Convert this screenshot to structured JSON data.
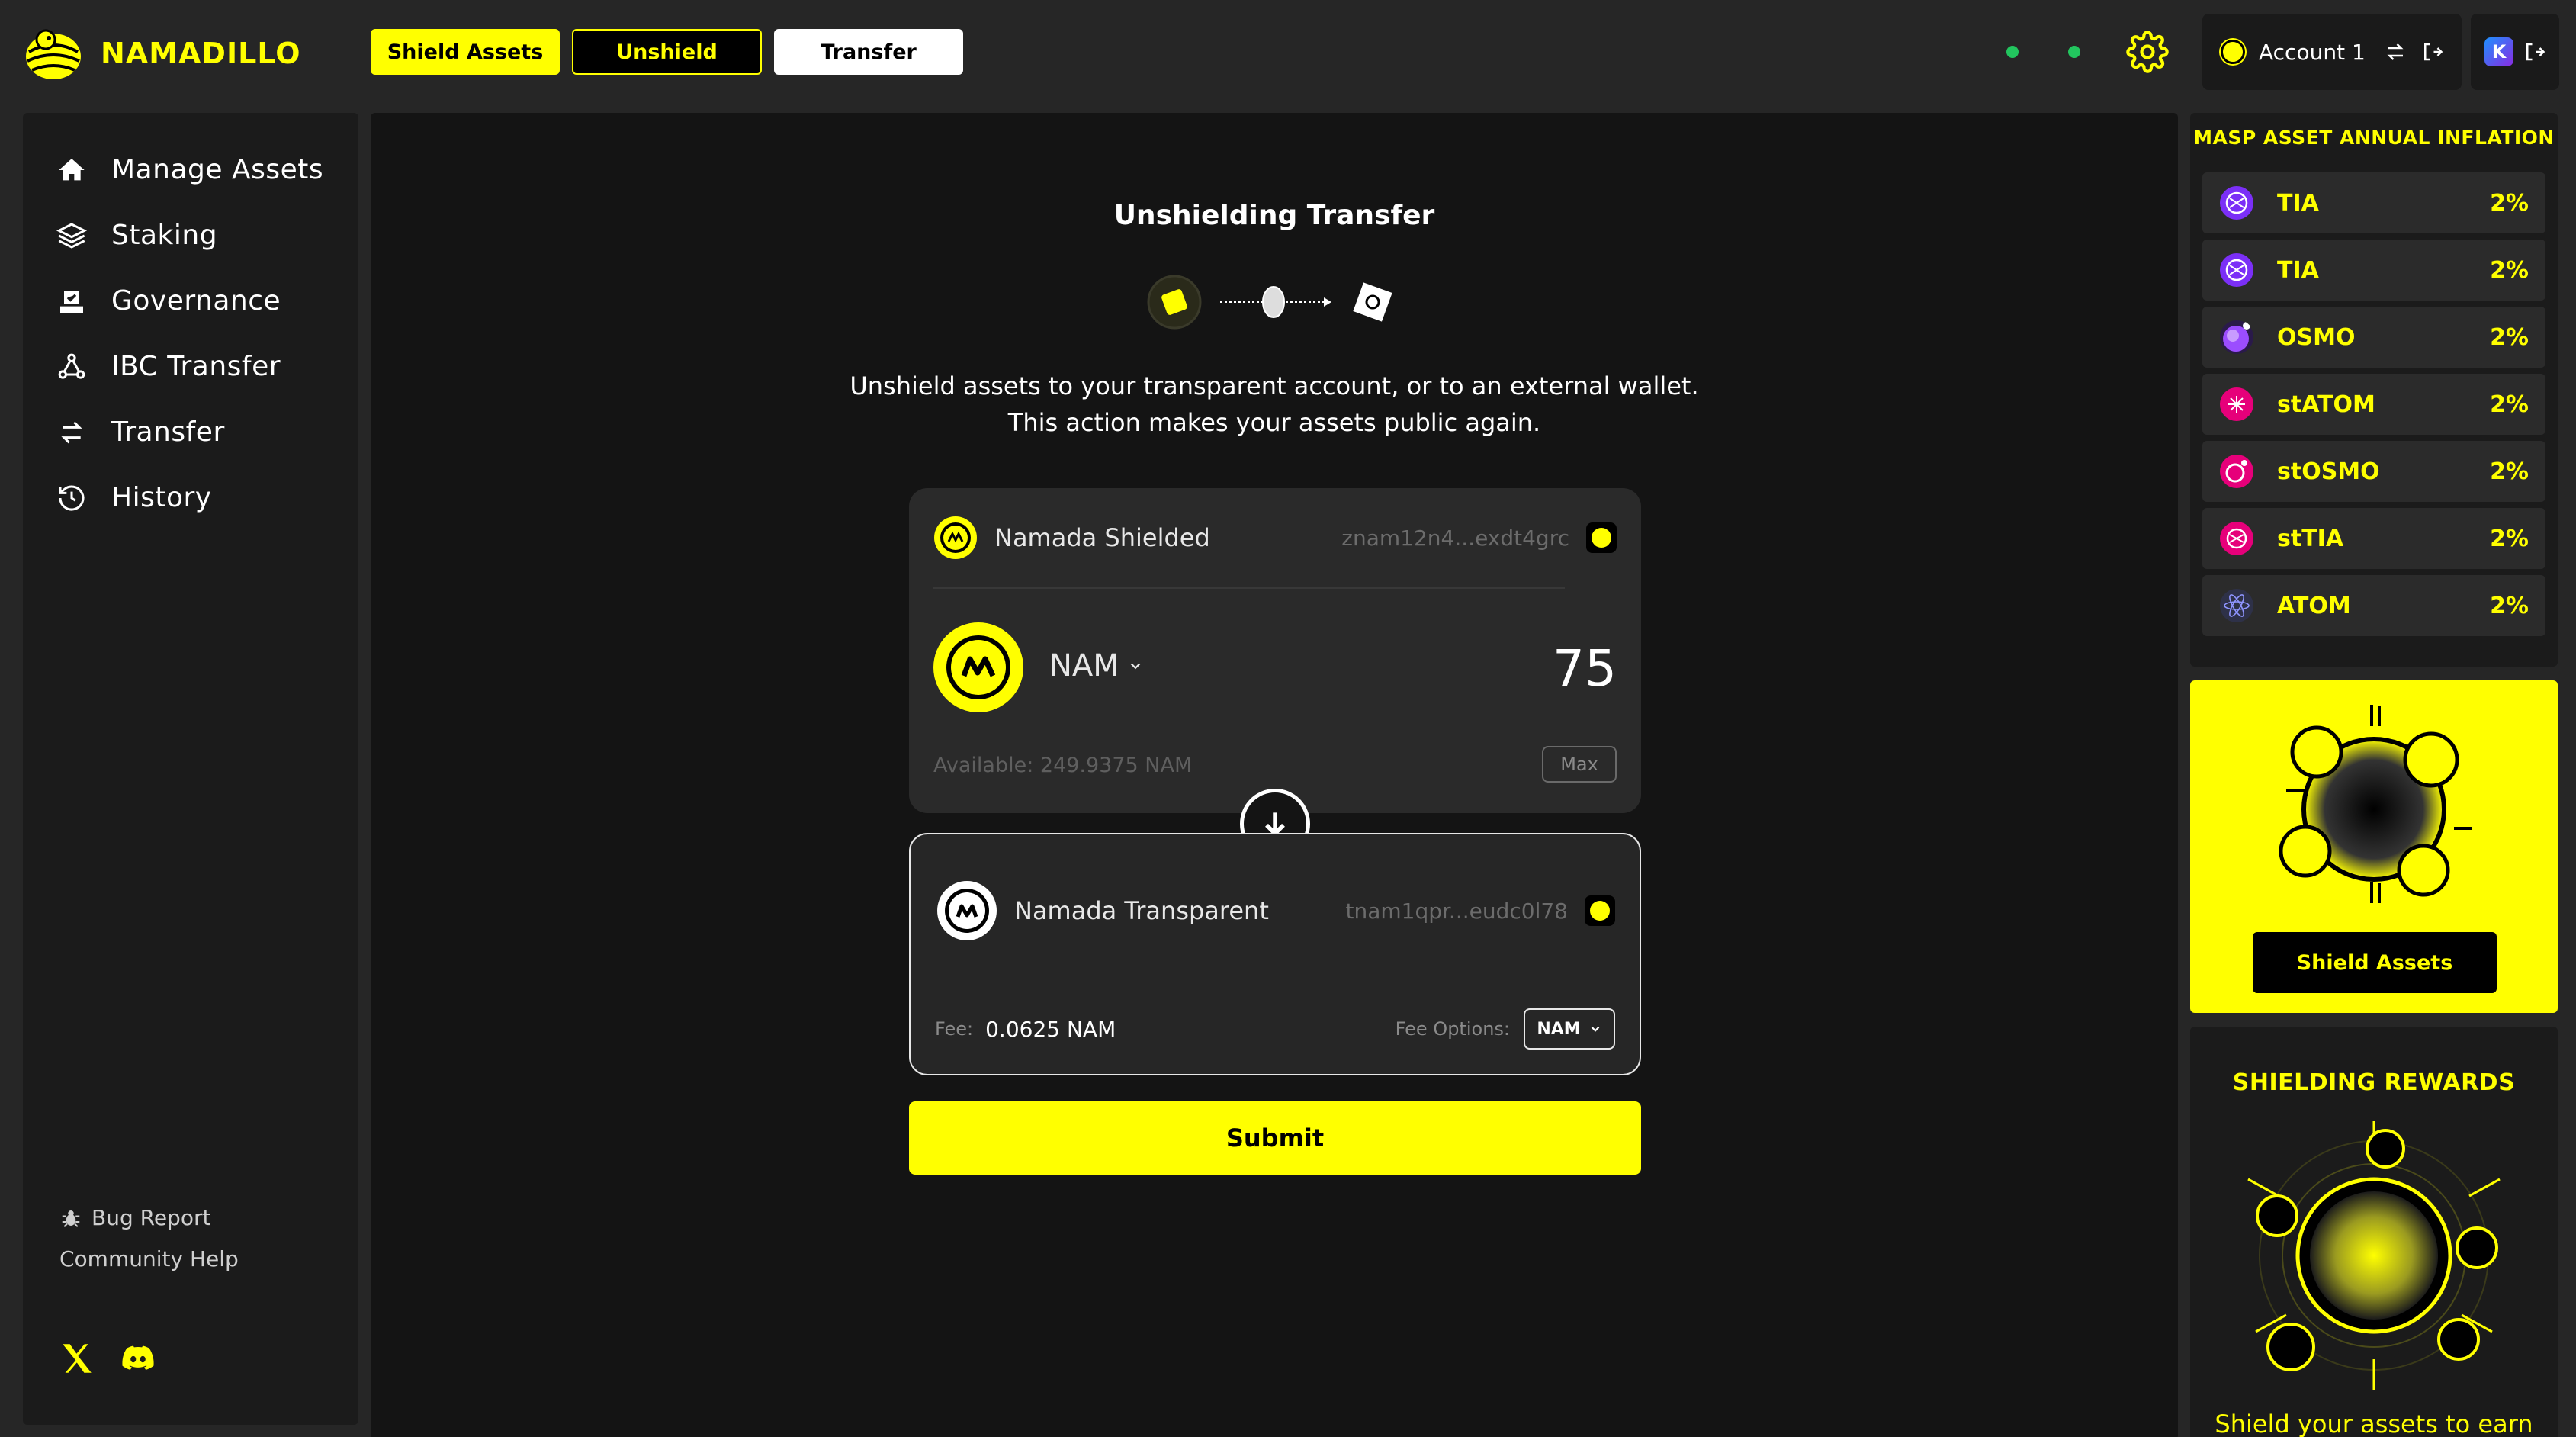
{
  "brand": {
    "name": "NAMADILLO",
    "accent": "#FFFF00"
  },
  "top_nav": {
    "shield_label": "Shield Assets",
    "unshield_label": "Unshield",
    "transfer_label": "Transfer"
  },
  "status_dots": {
    "color": "#22C55E"
  },
  "account": {
    "name": "Account 1",
    "wallet_icon": "K"
  },
  "sidebar": {
    "items": [
      {
        "label": "Manage Assets",
        "icon": "home-icon"
      },
      {
        "label": "Staking",
        "icon": "layers-icon"
      },
      {
        "label": "Governance",
        "icon": "ballot-icon"
      },
      {
        "label": "IBC Transfer",
        "icon": "network-icon"
      },
      {
        "label": "Transfer",
        "icon": "swap-icon"
      },
      {
        "label": "History",
        "icon": "history-icon"
      }
    ],
    "bug_report": "Bug Report",
    "community_help": "Community Help"
  },
  "transfer": {
    "title": "Unshielding Transfer",
    "description_line1": "Unshield assets to your transparent account, or to an external wallet.",
    "description_line2": "This action makes your assets public again.",
    "from": {
      "chain": "Namada Shielded",
      "address": "znam12n4...exdt4grc",
      "token": "NAM",
      "amount": "75",
      "available": "Available: 249.9375 NAM",
      "max_label": "Max"
    },
    "to": {
      "chain": "Namada Transparent",
      "address": "tnam1qpr...eudc0l78",
      "fee_label": "Fee:",
      "fee_value": "0.0625 NAM",
      "fee_options_label": "Fee Options:",
      "fee_token": "NAM"
    },
    "submit_label": "Submit"
  },
  "inflation": {
    "title": "MASP ASSET ANNUAL INFLATION",
    "assets": [
      {
        "name": "TIA",
        "rate": "2%",
        "color": "#7B2FF7"
      },
      {
        "name": "TIA",
        "rate": "2%",
        "color": "#7B2FF7"
      },
      {
        "name": "OSMO",
        "rate": "2%",
        "color": "#5E12A0"
      },
      {
        "name": "stATOM",
        "rate": "2%",
        "color": "#E6007A"
      },
      {
        "name": "stOSMO",
        "rate": "2%",
        "color": "#E6007A"
      },
      {
        "name": "stTIA",
        "rate": "2%",
        "color": "#E6007A"
      },
      {
        "name": "ATOM",
        "rate": "2%",
        "color": "#2E3148"
      }
    ]
  },
  "shield_promo": {
    "button_label": "Shield Assets"
  },
  "rewards": {
    "title": "SHIELDING REWARDS",
    "subtitle": "Shield your assets to earn"
  }
}
